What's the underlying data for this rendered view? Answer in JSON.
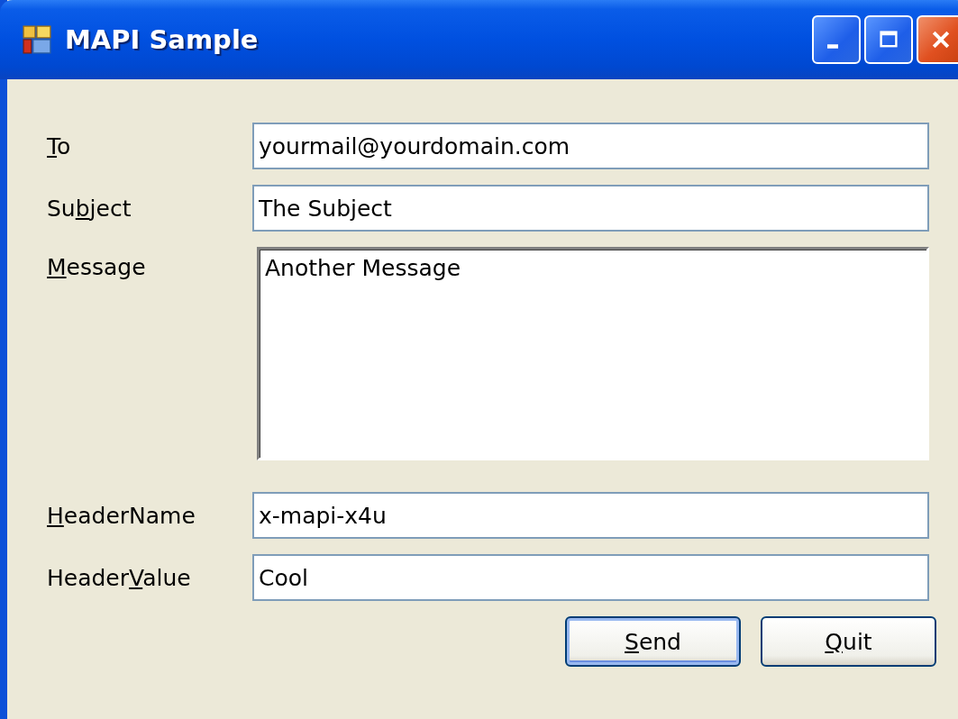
{
  "window": {
    "title": "MAPI Sample"
  },
  "fields": [
    {
      "kind": "line",
      "label": {
        "key": "T",
        "post": "o"
      },
      "value": "yourmail@yourdomain.com"
    },
    {
      "kind": "line",
      "label": {
        "pre": "Su",
        "key": "b",
        "post": "ject"
      },
      "value": "The Subject"
    },
    {
      "kind": "multiline",
      "label": {
        "key": "M",
        "post": "essage"
      },
      "value": "Another Message"
    },
    {
      "kind": "line",
      "label": {
        "key": "H",
        "post": "eaderName"
      },
      "value": "x-mapi-x4u"
    },
    {
      "kind": "line",
      "label": {
        "pre": "Header",
        "key": "V",
        "post": "alue"
      },
      "value": "Cool"
    }
  ],
  "buttons": [
    {
      "label": {
        "key": "S",
        "post": "end"
      },
      "default": true
    },
    {
      "label": {
        "key": "Q",
        "post": "uit"
      },
      "default": false
    }
  ]
}
